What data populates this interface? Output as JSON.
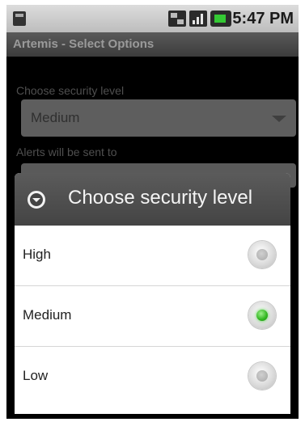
{
  "status_bar": {
    "time": "5:47 PM",
    "icons": [
      "sim-icon",
      "data-icon",
      "signal-icon",
      "battery-icon"
    ]
  },
  "app": {
    "title": "Artemis - Select Options"
  },
  "background_form": {
    "security_label": "Choose security level",
    "security_value": "Medium",
    "alerts_label": "Alerts will be sent to"
  },
  "dialog": {
    "title": "Choose security level",
    "options": [
      {
        "label": "High",
        "checked": false
      },
      {
        "label": "Medium",
        "checked": true
      },
      {
        "label": "Low",
        "checked": false
      }
    ]
  },
  "colors": {
    "radio_checked": "#2fb51e",
    "dialog_header": "#4d4d4d"
  }
}
